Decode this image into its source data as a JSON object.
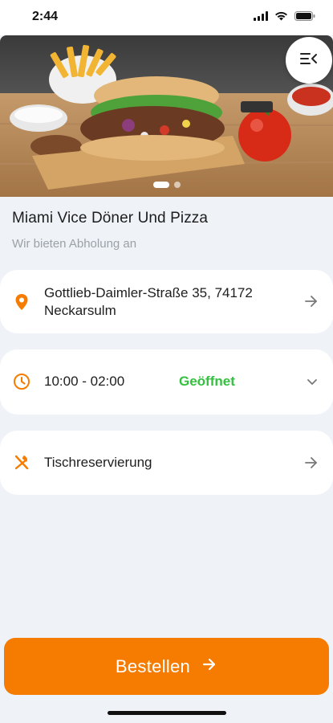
{
  "status_bar": {
    "time": "2:44",
    "icons": [
      "cellular-signal-icon",
      "wifi-icon",
      "battery-icon"
    ]
  },
  "hero": {
    "image_description_icon": "doner-food-photo",
    "carousel": {
      "page_count": 2,
      "active_index": 0
    },
    "menu_icon": "menu-collapse-icon"
  },
  "restaurant": {
    "name": "Miami Vice Döner Und Pizza",
    "subtitle": "Wir bieten Abholung an"
  },
  "address_card": {
    "icon": "location-pin-icon",
    "line1": "Gottlieb-Daimler-Straße 35, 74172",
    "line2": "Neckarsulm",
    "arrow_icon": "arrow-right-icon"
  },
  "hours_card": {
    "icon": "clock-icon",
    "hours": "10:00 - 02:00",
    "status": "Geöffnet",
    "chevron_icon": "chevron-down-icon"
  },
  "reservation_card": {
    "icon": "cutlery-icon",
    "label": "Tischreservierung",
    "arrow_icon": "arrow-right-icon"
  },
  "order_button": {
    "label": "Bestellen",
    "arrow_icon": "arrow-right-icon"
  },
  "colors": {
    "accent": "#f57c00",
    "open_green": "#35c041",
    "background": "#eff3f7"
  }
}
